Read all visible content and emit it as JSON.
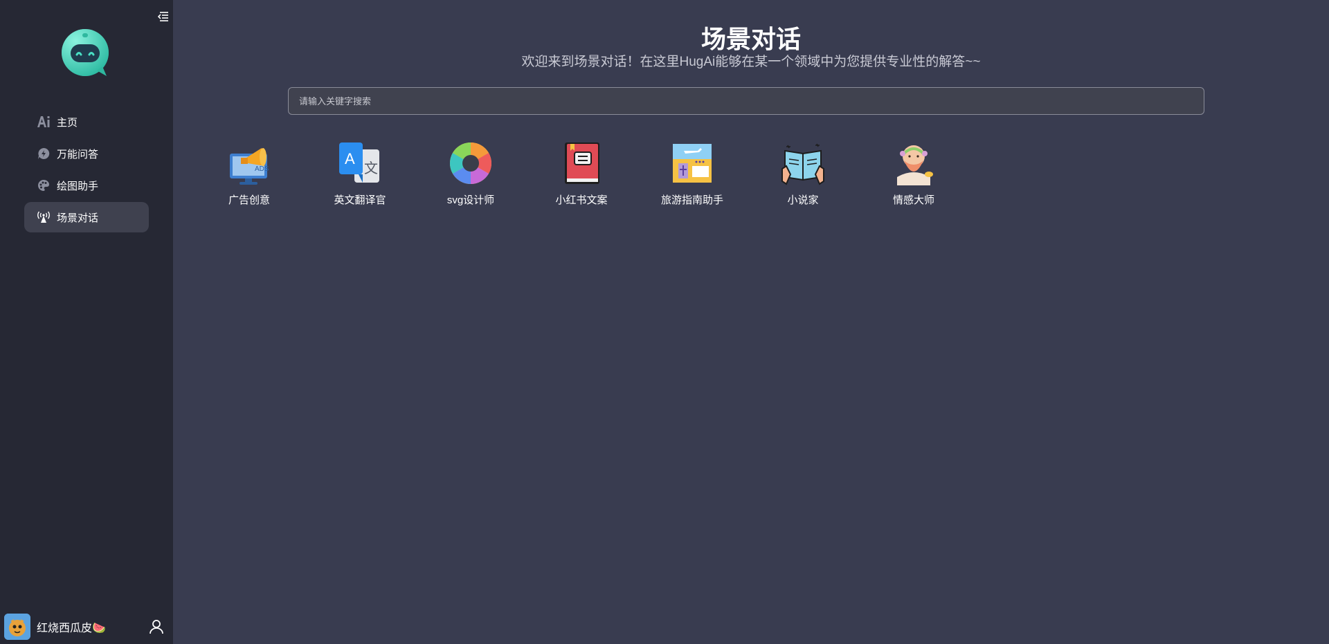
{
  "sidebar": {
    "items": [
      {
        "label": "主页",
        "icon": "ai-icon"
      },
      {
        "label": "万能问答",
        "icon": "chat-bolt-icon"
      },
      {
        "label": "绘图助手",
        "icon": "palette-icon"
      },
      {
        "label": "场景对话",
        "icon": "broadcast-icon",
        "active": true
      }
    ],
    "user": {
      "name": "红烧西瓜皮🍉"
    }
  },
  "main": {
    "title": "场景对话",
    "subtitle": "欢迎来到场景对话！在这里HugAi能够在某一个领域中为您提供专业性的解答~~",
    "search": {
      "placeholder": "请输入关键字搜索",
      "value": ""
    },
    "scenes": [
      {
        "label": "广告创意",
        "icon": "advertising-icon"
      },
      {
        "label": "英文翻译官",
        "icon": "translate-icon"
      },
      {
        "label": "svg设计师",
        "icon": "color-wheel-icon"
      },
      {
        "label": "小红书文案",
        "icon": "red-book-icon"
      },
      {
        "label": "旅游指南助手",
        "icon": "travel-icon"
      },
      {
        "label": "小说家",
        "icon": "reading-book-icon"
      },
      {
        "label": "情感大师",
        "icon": "philosopher-icon"
      }
    ]
  },
  "colors": {
    "sidebar_bg": "#262834",
    "main_bg": "#393c50",
    "active_item_bg": "#3f414f",
    "brand_teal": "#3fd6b8"
  }
}
